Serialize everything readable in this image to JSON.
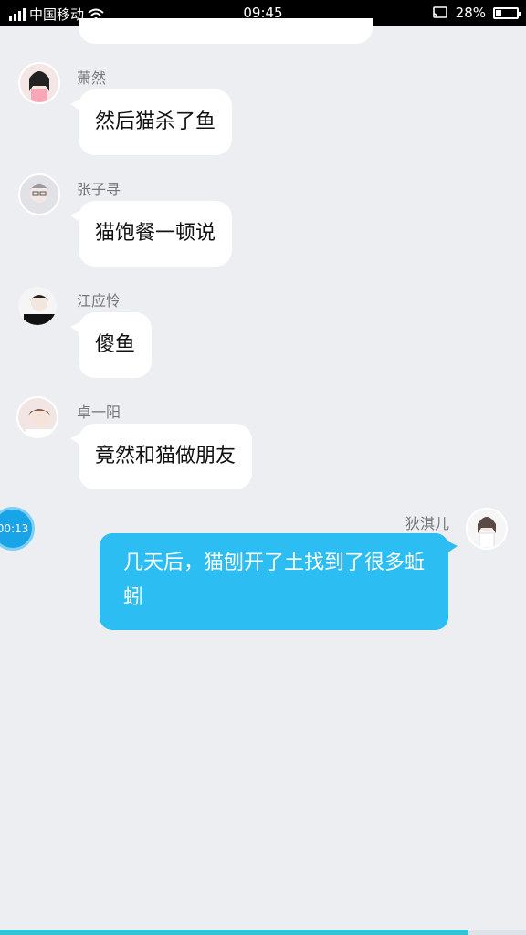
{
  "status_bar": {
    "carrier": "中国移动",
    "time": "09:45",
    "battery": "28%",
    "battery_level": 0.28
  },
  "messages": [
    {
      "sender": "萧然",
      "text": "然后猫杀了鱼",
      "avatar_icon": "girl-pink-avatar-icon"
    },
    {
      "sender": "张子寻",
      "text": "猫饱餐一顿说",
      "avatar_icon": "boy-glasses-avatar-icon"
    },
    {
      "sender": "江应怜",
      "text": "傻鱼",
      "avatar_icon": "boy-dark-avatar-icon"
    },
    {
      "sender": "卓一阳",
      "text": "竟然和猫做朋友",
      "avatar_icon": "boy-brown-avatar-icon"
    },
    {
      "sender": "狄淇儿",
      "text": "几天后，猫刨开了土找到了很多蚯蚓",
      "avatar_icon": "girl-white-avatar-icon",
      "mine": true
    }
  ],
  "timer": "00:13",
  "playback_progress": 0.89,
  "colors": {
    "my_bubble": "#2cbdf2",
    "progress": "#33c3d6",
    "timer": "#1aa4e8"
  }
}
